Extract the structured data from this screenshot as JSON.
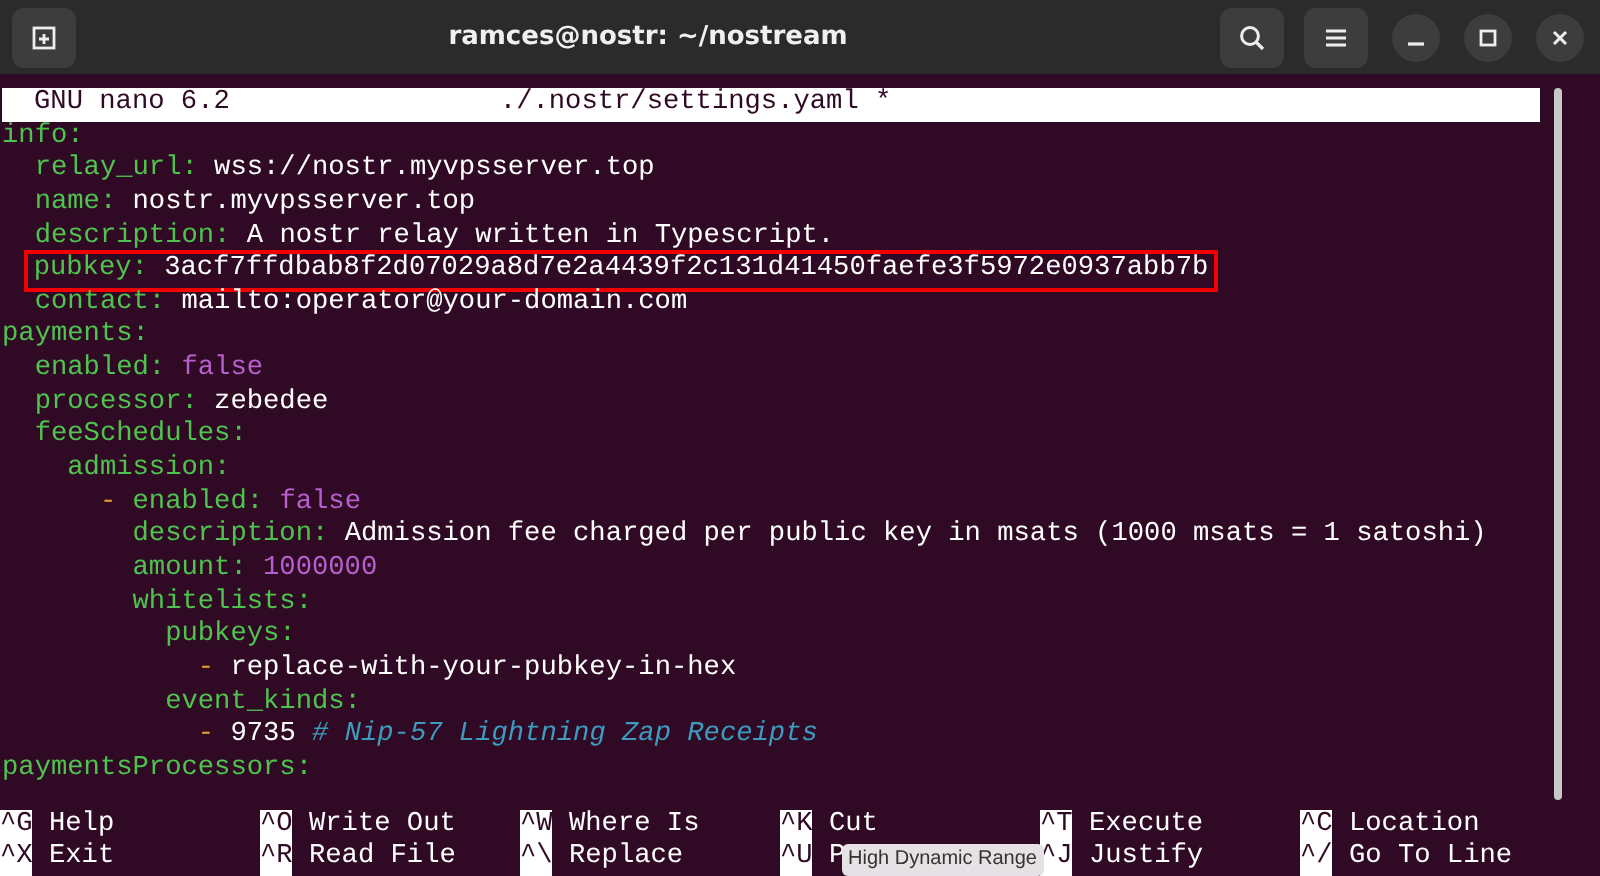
{
  "window": {
    "title": "ramces@nostr: ~/nostream"
  },
  "editor": {
    "header": {
      "version": "GNU nano 6.2",
      "file": "./.nostr/settings.yaml *"
    },
    "document": [
      {
        "key": "info:",
        "highlighted": false,
        "children": [
          {
            "key": "relay_url:",
            "value": "wss://nostr.myvpsserver.top",
            "kind": "string",
            "highlighted": false
          },
          {
            "key": "name:",
            "value": "nostr.myvpsserver.top",
            "kind": "string",
            "highlighted": false
          },
          {
            "key": "description:",
            "value": "A nostr relay written in Typescript.",
            "kind": "string",
            "highlighted": false
          },
          {
            "key": "pubkey:",
            "value": "3acf7ffdbab8f2d07029a8d7e2a4439f2c131d41450faefe3f5972e0937abb7b",
            "kind": "string",
            "highlighted": true
          },
          {
            "key": "contact:",
            "value": "mailto:operator@your-domain.com",
            "kind": "string",
            "highlighted": false
          }
        ]
      },
      {
        "key": "payments:",
        "highlighted": false,
        "children": [
          {
            "key": "enabled:",
            "value": "false",
            "kind": "literal",
            "highlighted": false
          },
          {
            "key": "processor:",
            "value": "zebedee",
            "kind": "string",
            "highlighted": false
          },
          {
            "key": "feeSchedules:",
            "highlighted": false,
            "children": [
              {
                "key": "admission:",
                "highlighted": false,
                "children": [
                  {
                    "dash": "-",
                    "highlighted": false,
                    "children": [
                      {
                        "key": "enabled:",
                        "value": "false",
                        "kind": "literal",
                        "highlighted": false
                      },
                      {
                        "key": "description:",
                        "value": "Admission fee charged per public key in msats (1000 msats = 1 satoshi)",
                        "kind": "string",
                        "highlighted": false
                      },
                      {
                        "key": "amount:",
                        "value": "1000000",
                        "kind": "literal",
                        "highlighted": false
                      },
                      {
                        "key": "whitelists:",
                        "highlighted": false,
                        "children": [
                          {
                            "key": "pubkeys:",
                            "highlighted": false,
                            "children": [
                              {
                                "dash": "-",
                                "value": "replace-with-your-pubkey-in-hex",
                                "kind": "string",
                                "highlighted": false
                              }
                            ]
                          },
                          {
                            "key": "event_kinds:",
                            "highlighted": false,
                            "children": [
                              {
                                "dash": "-",
                                "value": "9735",
                                "kind": "string",
                                "comment": "# Nip-57 Lightning Zap Receipts",
                                "highlighted": false
                              }
                            ]
                          }
                        ]
                      }
                    ]
                  }
                ]
              }
            ]
          }
        ]
      },
      {
        "key": "paymentsProcessors:",
        "highlighted": false
      }
    ]
  },
  "shortcuts": [
    {
      "key": "^G",
      "label": "Help"
    },
    {
      "key": "^O",
      "label": "Write Out"
    },
    {
      "key": "^W",
      "label": "Where Is"
    },
    {
      "key": "^K",
      "label": "Cut"
    },
    {
      "key": "^T",
      "label": "Execute"
    },
    {
      "key": "^C",
      "label": "Location"
    },
    {
      "key": "^X",
      "label": "Exit"
    },
    {
      "key": "^R",
      "label": "Read File"
    },
    {
      "key": "^\\",
      "label": "Replace"
    },
    {
      "key": "^U",
      "label": "P"
    },
    {
      "key": "^J",
      "label": "Justify"
    },
    {
      "key": "^/",
      "label": "Go To Line"
    }
  ],
  "tooltip": {
    "text": "High Dynamic Range"
  }
}
